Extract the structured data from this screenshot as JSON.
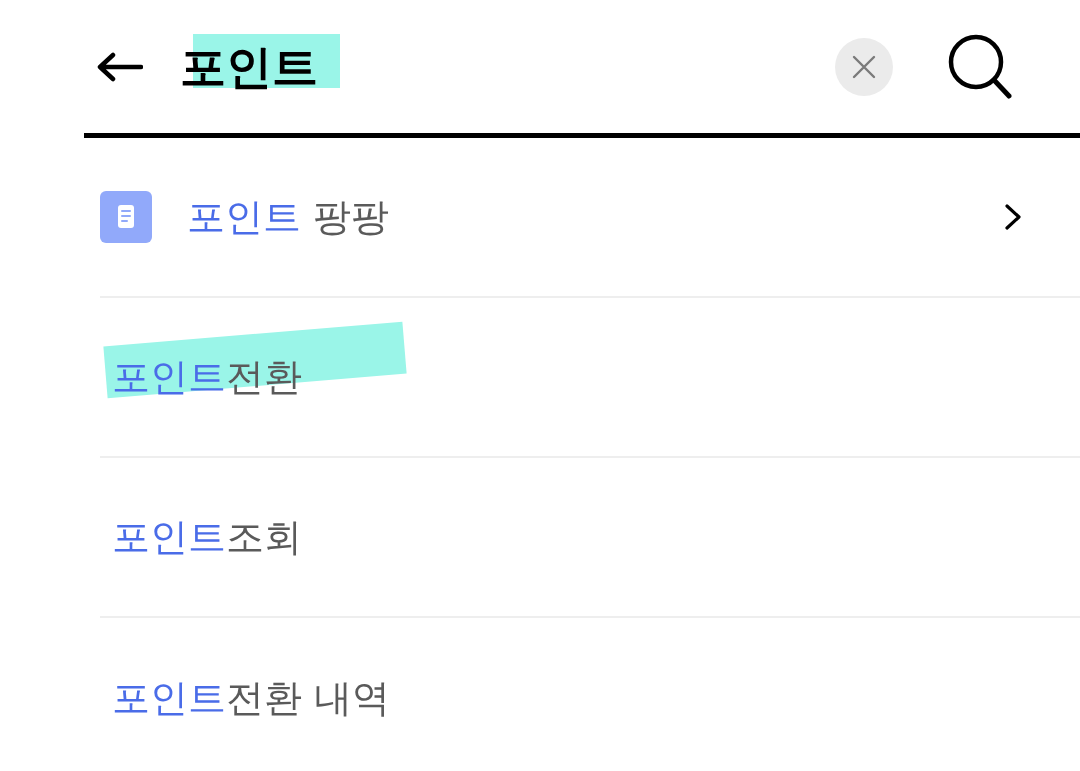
{
  "search": {
    "value": "포인트",
    "highlighted": true
  },
  "results": [
    {
      "kind": "menu",
      "match": "포인트",
      "rest": " 팡팡",
      "highlighted": false
    },
    {
      "kind": "keyword",
      "match": "포인트",
      "rest": "전환",
      "highlighted": true
    },
    {
      "kind": "keyword",
      "match": "포인트",
      "rest": "조회",
      "highlighted": false
    },
    {
      "kind": "keyword",
      "match": "포인트",
      "rest": "전환 내역",
      "highlighted": false
    }
  ]
}
